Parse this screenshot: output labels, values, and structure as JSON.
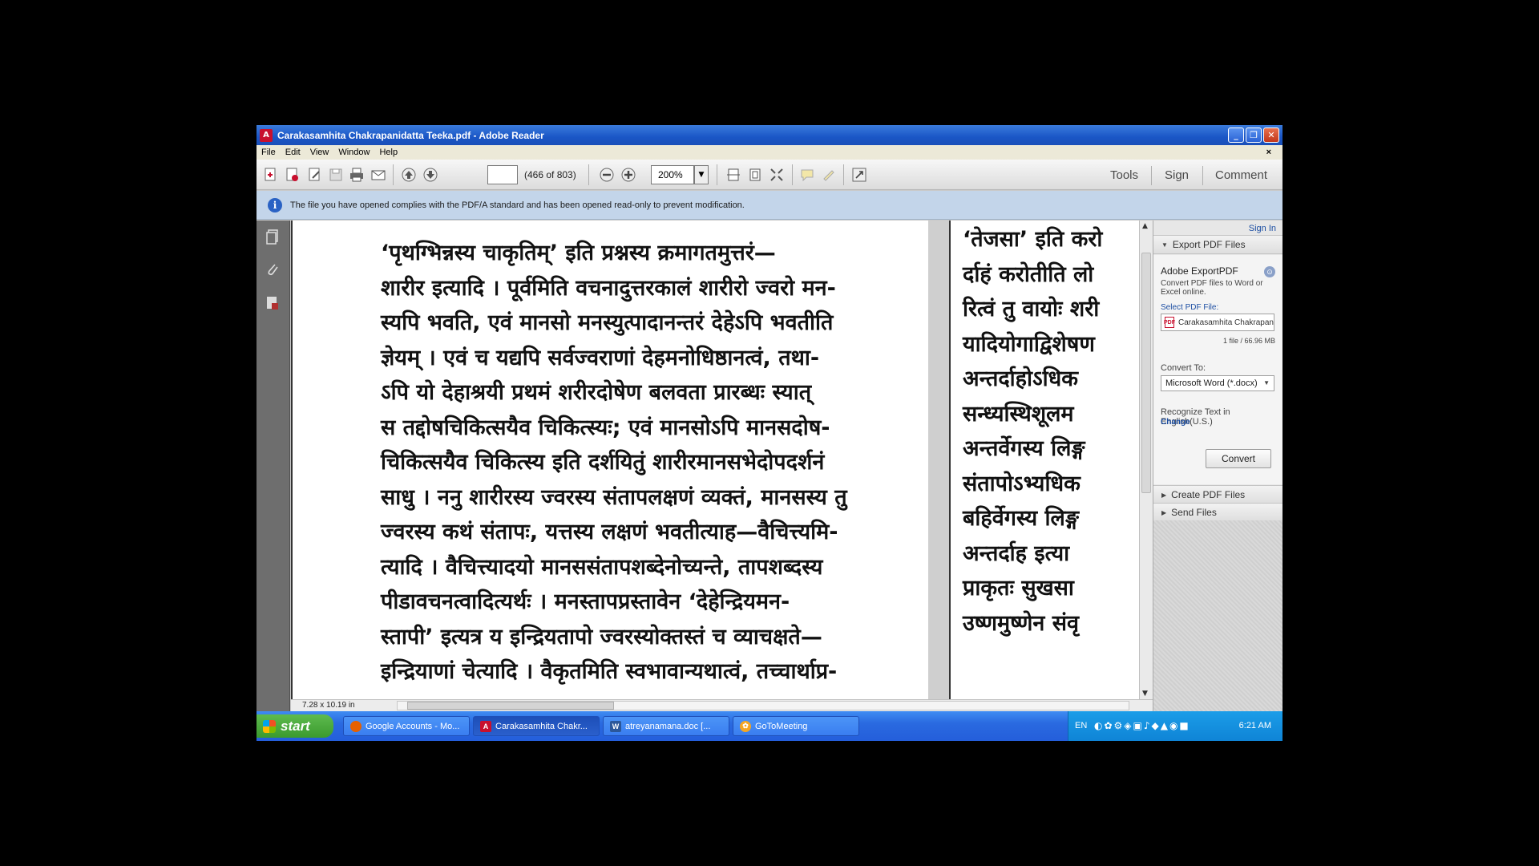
{
  "window": {
    "title": "Carakasamhita Chakrapanidatta Teeka.pdf - Adobe Reader",
    "minimize_label": "_",
    "maximize_label": "❐",
    "close_label": "✕"
  },
  "menu": {
    "file": "File",
    "edit": "Edit",
    "view": "View",
    "window": "Window",
    "help": "Help",
    "close_doc": "×"
  },
  "toolbar": {
    "page_input_value": "",
    "page_count": "(466 of 803)",
    "zoom_value": "200%",
    "tools_label": "Tools",
    "sign_label": "Sign",
    "comment_label": "Comment"
  },
  "infobar": {
    "message": "The file you have opened complies with the PDF/A standard and has been opened read-only to prevent modification."
  },
  "document": {
    "page_left_lines": [
      "‘पृथग्भिन्नस्य चाकृतिम्’ इति प्रश्नस्य क्रमागतमुत्तरं—",
      "शारीर इत्यादि । पूर्वमिति वचनादुत्तरकालं शारीरो ज्वरो मन-",
      "स्यपि भवति, एवं मानसो मनस्युत्पादानन्तरं देहेऽपि भवतीति",
      "ज्ञेयम् । एवं च यद्यपि सर्वज्वराणां देहमनोधिष्ठानत्वं, तथा-",
      "ऽपि यो देहाश्रयी प्रथमं शरीरदोषेण बलवता प्रारब्धः स्यात्",
      "स तद्दोषचिकित्सयैव चिकित्स्यः; एवं मानसोऽपि मानसदोष-",
      "चिकित्सयैव चिकित्स्य इति दर्शयितुं शारीरमानसभेदोपदर्शनं",
      "साधु । ननु शारीरस्य ज्वरस्य संतापलक्षणं व्यक्तं, मानसस्य तु",
      "ज्वरस्य कथं संतापः, यत्तस्य लक्षणं भवतीत्याह—वैचित्त्यमि-",
      "त्यादि । वैचित्त्यादयो मानससंतापशब्देनोच्यन्ते, तापशब्दस्य",
      "पीडावचनत्वादित्यर्थः । मनस्तापप्रस्तावेन ‘देहेन्द्रियमन-",
      "स्तापी’ इत्यत्र य इन्द्रियतापो ज्वरस्योक्तस्तं च व्याचक्षते—",
      "इन्द्रियाणां चेत्यादि । वैकृतमिति स्वभावान्यथात्वं, तच्चार्थाप्र-"
    ],
    "page_right_lines": [
      "‘तेजसा’ इति करो",
      "र्दाहं करोतीति लो",
      "रित्वं तु वायोः शरी",
      "यादियोगाद्विशेषण",
      "अन्तर्दाहोऽधिक",
      "सन्ध्यस्थिशूलम",
      "अन्तर्वेगस्य लिङ्ग",
      "संतापोऽभ्यधिक",
      "बहिर्वेगस्य लिङ्ग",
      "अन्तर्दाह इत्या",
      "प्राकृतः सुखसा",
      "उष्णमुष्णेन संवृ"
    ],
    "page_size": "7.28 x 10.19 in"
  },
  "right_panel": {
    "sign_in": "Sign In",
    "export_header": "Export PDF Files",
    "export_title": "Adobe ExportPDF",
    "export_desc": "Convert PDF files to Word or Excel online.",
    "select_label": "Select PDF File:",
    "selected_file": "Carakasamhita Chakrapanidatta T...",
    "file_info": "1 file / 66.96 MB",
    "convert_to_label": "Convert To:",
    "convert_to_value": "Microsoft Word (*.docx)",
    "recognize_text": "Recognize Text in English(U.S.)",
    "change_link": "Change",
    "convert_button": "Convert",
    "create_header": "Create PDF Files",
    "send_header": "Send Files"
  },
  "taskbar": {
    "start_label": "start",
    "tasks": [
      {
        "label": "Google Accounts - Mo...",
        "icon": "firefox-icon"
      },
      {
        "label": "Carakasamhita Chakr...",
        "icon": "adobe-reader-icon"
      },
      {
        "label": "atreyanamana.doc [...",
        "icon": "word-doc-icon"
      },
      {
        "label": "GoToMeeting",
        "icon": "gotomeeting-icon"
      }
    ],
    "language": "EN",
    "clock": "6:21 AM"
  }
}
